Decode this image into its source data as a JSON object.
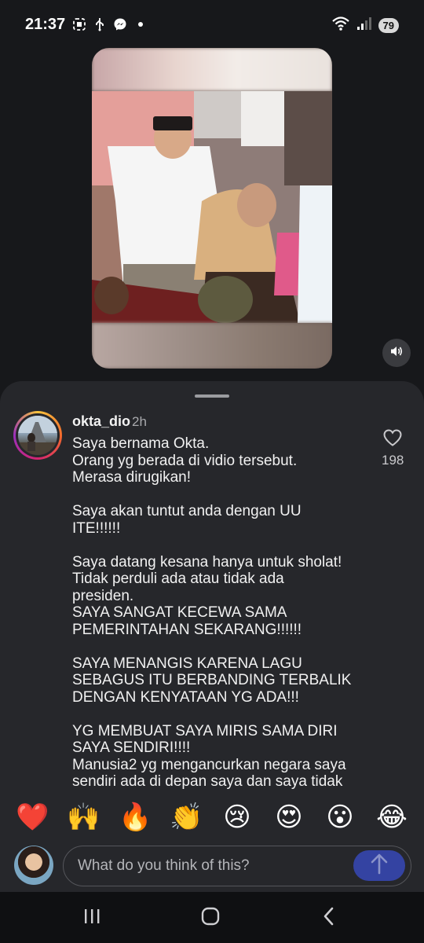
{
  "status_bar": {
    "time": "21:37",
    "battery": "79",
    "left_icons": [
      "screenshot-icon",
      "usb-icon",
      "messenger-icon",
      "dot-icon"
    ],
    "right_icons": [
      "wifi-icon",
      "signal-icon"
    ]
  },
  "video": {
    "mute_icon": "speaker-icon"
  },
  "comment": {
    "username": "okta_dio",
    "time_ago": "2h",
    "text": "Saya bernama Okta.\nOrang yg berada di vidio tersebut.\nMerasa dirugikan!\n\nSaya akan tuntut anda dengan UU\nITE!!!!!!\n\nSaya datang kesana hanya untuk sholat!\nTidak perduli ada atau tidak ada\npresiden.\nSAYA SANGAT KECEWA SAMA\nPEMERINTAHAN SEKARANG!!!!!!\n\nSAYA MENANGIS KARENA LAGU\nSEBAGUS ITU BERBANDING TERBALIK\nDENGAN KENYATAAN YG ADA!!!\n\nYG MEMBUAT SAYA MIRIS SAMA DIRI\nSAYA SENDIRI!!!!\nManusia2 yg mengancurkan negara saya\nsendiri ada di depan saya dan saya tidak",
    "like_count": "198",
    "like_icon": "heart-outline-icon"
  },
  "emoji_bar": [
    "❤️",
    "🙌",
    "🔥",
    "👏",
    "😢",
    "😍",
    "😮",
    "😂"
  ],
  "input": {
    "placeholder": "What do you think of this?",
    "send_icon": "arrow-up-icon"
  },
  "navbar": [
    "recent-apps-icon",
    "home-icon",
    "back-icon"
  ],
  "colors": {
    "background": "#17181b",
    "sheet": "#26272b",
    "send_button": "#3443a2",
    "text_secondary": "#a8a9ad"
  }
}
